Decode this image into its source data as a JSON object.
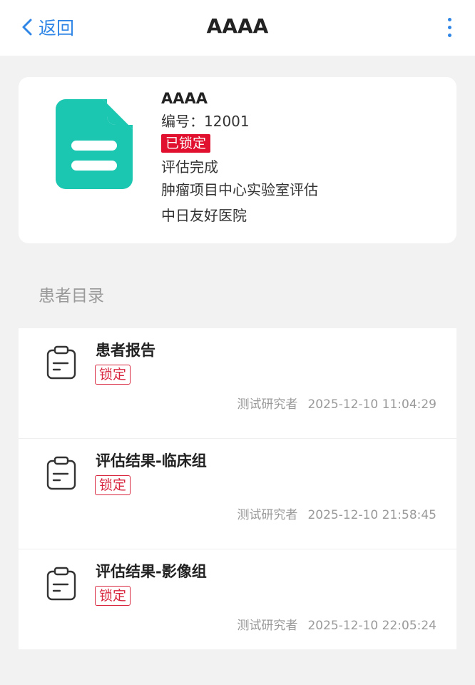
{
  "header": {
    "back_label": "返回",
    "title": "AAAA",
    "accent_color": "#2f86e6"
  },
  "project": {
    "name": "AAAA",
    "code_label": "编号：",
    "code": "12001",
    "lock_badge": "已锁定",
    "status": "评估完成",
    "evaluation_type": "肿瘤项目中心实验室评估",
    "hospital": "中日友好医院",
    "icon": "document-icon",
    "icon_color": "#1cc7b1"
  },
  "catalog": {
    "section_title": "患者目录",
    "items": [
      {
        "title": "患者报告",
        "badge": "锁定",
        "author": "测试研究者",
        "timestamp": "2025-12-10 11:04:29",
        "icon": "clipboard-icon"
      },
      {
        "title": "评估结果-临床组",
        "badge": "锁定",
        "author": "测试研究者",
        "timestamp": "2025-12-10 21:58:45",
        "icon": "clipboard-icon"
      },
      {
        "title": "评估结果-影像组",
        "badge": "锁定",
        "author": "测试研究者",
        "timestamp": "2025-12-10 22:05:24",
        "icon": "clipboard-icon"
      }
    ]
  }
}
